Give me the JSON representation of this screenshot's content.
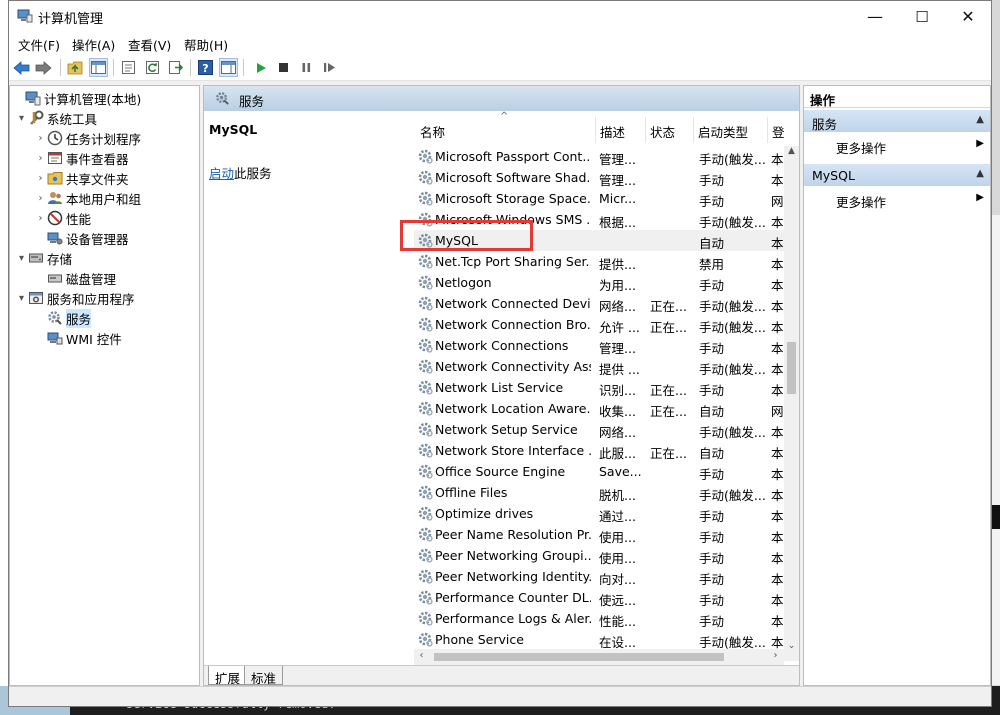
{
  "window": {
    "title": "计算机管理",
    "controls": {
      "minimize": "—",
      "maximize": "☐",
      "close": "✕"
    }
  },
  "menu": [
    {
      "label": "文件(F)"
    },
    {
      "label": "操作(A)"
    },
    {
      "label": "查看(V)"
    },
    {
      "label": "帮助(H)"
    }
  ],
  "tree": {
    "items": [
      {
        "label": "计算机管理(本地)",
        "icon": "computer-management-icon",
        "level": 0,
        "arrow": ""
      },
      {
        "label": "系统工具",
        "icon": "system-tools-icon",
        "level": 1,
        "arrow": "▾"
      },
      {
        "label": "任务计划程序",
        "icon": "task-scheduler-icon",
        "level": 2,
        "arrow": "›"
      },
      {
        "label": "事件查看器",
        "icon": "event-viewer-icon",
        "level": 2,
        "arrow": "›"
      },
      {
        "label": "共享文件夹",
        "icon": "shared-folder-icon",
        "level": 2,
        "arrow": "›"
      },
      {
        "label": "本地用户和组",
        "icon": "users-icon",
        "level": 2,
        "arrow": "›"
      },
      {
        "label": "性能",
        "icon": "performance-icon",
        "level": 2,
        "arrow": "›"
      },
      {
        "label": "设备管理器",
        "icon": "device-manager-icon",
        "level": 2,
        "arrow": ""
      },
      {
        "label": "存储",
        "icon": "storage-icon",
        "level": 1,
        "arrow": "▾"
      },
      {
        "label": "磁盘管理",
        "icon": "disk-management-icon",
        "level": 2,
        "arrow": ""
      },
      {
        "label": "服务和应用程序",
        "icon": "services-apps-icon",
        "level": 1,
        "arrow": "▾"
      },
      {
        "label": "服务",
        "icon": "services-icon",
        "level": 2,
        "arrow": "",
        "selected": true
      },
      {
        "label": "WMI 控件",
        "icon": "wmi-control-icon",
        "level": 2,
        "arrow": ""
      }
    ]
  },
  "middle": {
    "header": "服务",
    "selected_service": "MySQL",
    "start_link": "启动",
    "start_suffix": "此服务",
    "columns": [
      "名称",
      "描述",
      "状态",
      "启动类型",
      "登"
    ],
    "services": [
      {
        "name": "Microsoft Passport Cont...",
        "desc": "管理...",
        "status": "",
        "startup": "手动(触发...",
        "logon": "本"
      },
      {
        "name": "Microsoft Software Shad...",
        "desc": "管理...",
        "status": "",
        "startup": "手动",
        "logon": "本"
      },
      {
        "name": "Microsoft Storage Space...",
        "desc": "Micr...",
        "status": "",
        "startup": "手动",
        "logon": "网"
      },
      {
        "name": "Microsoft Windows SMS ...",
        "desc": "根据...",
        "status": "",
        "startup": "手动(触发...",
        "logon": "本"
      },
      {
        "name": "MySQL",
        "desc": "",
        "status": "",
        "startup": "自动",
        "logon": "本"
      },
      {
        "name": "Net.Tcp Port Sharing Ser...",
        "desc": "提供...",
        "status": "",
        "startup": "禁用",
        "logon": "本"
      },
      {
        "name": "Netlogon",
        "desc": "为用...",
        "status": "",
        "startup": "手动",
        "logon": "本"
      },
      {
        "name": "Network Connected Devi...",
        "desc": "网络...",
        "status": "正在...",
        "startup": "手动(触发...",
        "logon": "本"
      },
      {
        "name": "Network Connection Bro...",
        "desc": "允许 ...",
        "status": "正在...",
        "startup": "手动(触发...",
        "logon": "本"
      },
      {
        "name": "Network Connections",
        "desc": "管理...",
        "status": "",
        "startup": "手动",
        "logon": "本"
      },
      {
        "name": "Network Connectivity Ass...",
        "desc": "提供 ...",
        "status": "",
        "startup": "手动(触发...",
        "logon": "本"
      },
      {
        "name": "Network List Service",
        "desc": "识别...",
        "status": "正在...",
        "startup": "手动",
        "logon": "本"
      },
      {
        "name": "Network Location Aware...",
        "desc": "收集...",
        "status": "正在...",
        "startup": "自动",
        "logon": "网"
      },
      {
        "name": "Network Setup Service",
        "desc": "网络...",
        "status": "",
        "startup": "手动(触发...",
        "logon": "本"
      },
      {
        "name": "Network Store Interface ...",
        "desc": "此服...",
        "status": "正在...",
        "startup": "自动",
        "logon": "本"
      },
      {
        "name": "Office  Source Engine",
        "desc": "Save...",
        "status": "",
        "startup": "手动",
        "logon": "本"
      },
      {
        "name": "Offline Files",
        "desc": "脱机...",
        "status": "",
        "startup": "手动(触发...",
        "logon": "本"
      },
      {
        "name": "Optimize drives",
        "desc": "通过...",
        "status": "",
        "startup": "手动",
        "logon": "本"
      },
      {
        "name": "Peer Name Resolution Pr...",
        "desc": "使用...",
        "status": "",
        "startup": "手动",
        "logon": "本"
      },
      {
        "name": "Peer Networking Groupi...",
        "desc": "使用...",
        "status": "",
        "startup": "手动",
        "logon": "本"
      },
      {
        "name": "Peer Networking Identity...",
        "desc": "向对...",
        "status": "",
        "startup": "手动",
        "logon": "本"
      },
      {
        "name": "Performance Counter DL...",
        "desc": "使远...",
        "status": "",
        "startup": "手动",
        "logon": "本"
      },
      {
        "name": "Performance Logs & Aler...",
        "desc": "性能...",
        "status": "",
        "startup": "手动",
        "logon": "本"
      },
      {
        "name": "Phone Service",
        "desc": "在设...",
        "status": "",
        "startup": "手动(触发...",
        "logon": "本"
      }
    ],
    "tabs": [
      "扩展",
      "标准"
    ]
  },
  "actions": {
    "header": "操作",
    "sections": [
      {
        "title": "服务",
        "item": "更多操作"
      },
      {
        "title": "MySQL",
        "item": "更多操作"
      }
    ]
  },
  "background": {
    "terminal_text": "service successfully removed."
  },
  "colors": {
    "highlight_box": "#e53935",
    "selection": "#cce8ff",
    "link": "#1a5fb4"
  }
}
